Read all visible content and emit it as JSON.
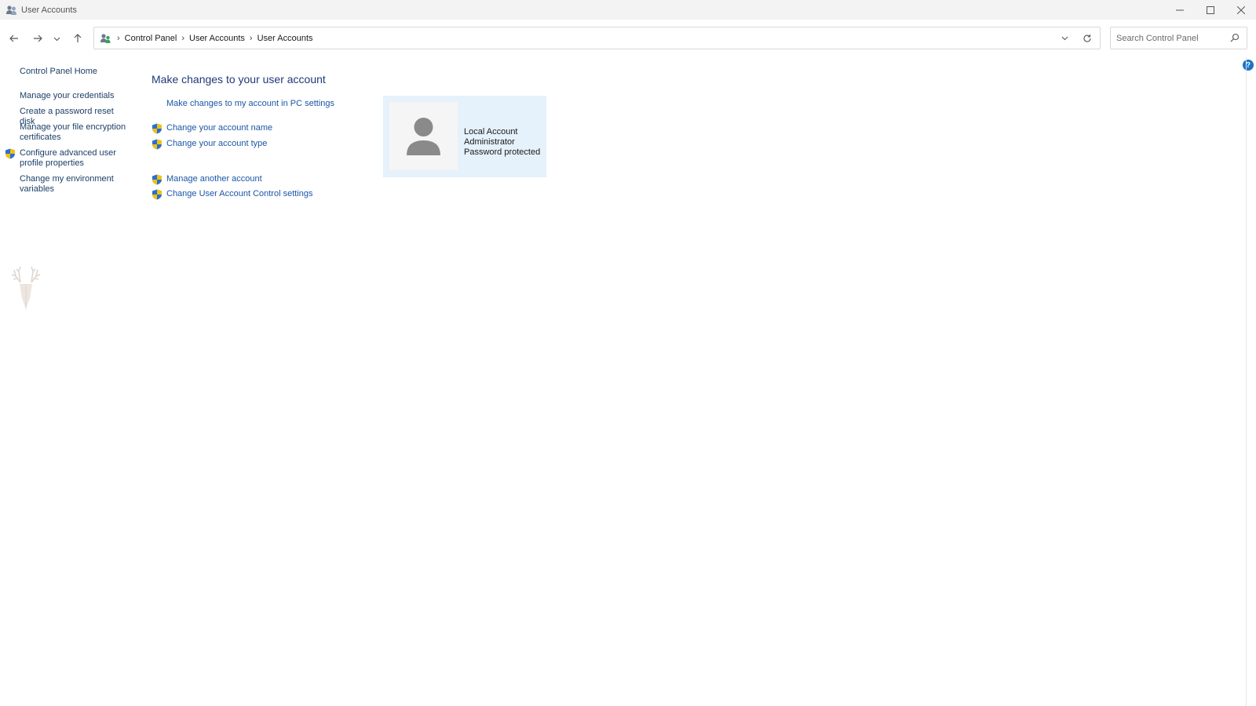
{
  "window": {
    "title": "User Accounts"
  },
  "address": {
    "breadcrumbs": [
      "Control Panel",
      "User Accounts",
      "User Accounts"
    ]
  },
  "search": {
    "placeholder": "Search Control Panel"
  },
  "sidebar": {
    "items": [
      {
        "label": "Control Panel Home",
        "shield": false
      },
      {
        "label": "Manage your credentials",
        "shield": false
      },
      {
        "label": "Create a password reset disk",
        "shield": false
      },
      {
        "label": "Manage your file encryption certificates",
        "shield": false
      },
      {
        "label": "Configure advanced user profile properties",
        "shield": true
      },
      {
        "label": "Change my environment variables",
        "shield": false
      }
    ]
  },
  "main": {
    "title": "Make changes to your user account",
    "links": [
      {
        "label": "Make changes to my account in PC settings",
        "shield": false
      },
      {
        "label": "Change your account name",
        "shield": true
      },
      {
        "label": "Change your account type",
        "shield": true
      },
      {
        "label": "Manage another account",
        "shield": true
      },
      {
        "label": "Change User Account Control settings",
        "shield": true
      }
    ]
  },
  "account": {
    "lines": [
      "Local Account",
      "Administrator",
      "Password protected"
    ]
  },
  "help": {
    "glyph": "?"
  },
  "colors": {
    "link": "#1a56a5",
    "title": "#1e3a78",
    "card_bg": "#e5f1fb",
    "shield_blue": "#2a6fd1",
    "shield_yellow": "#f2c10f"
  }
}
